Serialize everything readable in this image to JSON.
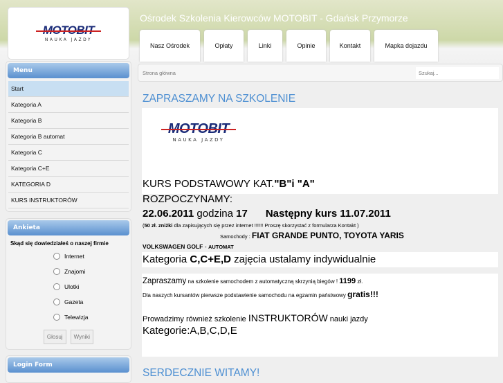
{
  "header": {
    "logo_main": "MOTOBIT",
    "logo_sub": "NAUKA JAZDY",
    "title": "Ośrodek Szkolenia Kierowców MOTOBIT - Gdańsk Przymorze",
    "nav": [
      "Nasz Ośrodek",
      "Opłaty",
      "Linki",
      "Opinie",
      "Kontakt",
      "Mapka dojazdu"
    ]
  },
  "breadcrumb": "Strona główna",
  "search_placeholder": "Szukaj...",
  "menu": {
    "title": "Menu",
    "items": [
      "Start",
      "Kategoria A",
      "Kategoria B",
      "Kategoria B automat",
      "Kategoria C",
      "Kategoria C+E",
      "KATEGORIA D",
      "KURS INSTRUKTORÓW"
    ]
  },
  "poll": {
    "title": "Ankieta",
    "question": "Skąd się dowiedziałeś o naszej firmie",
    "options": [
      "Internet",
      "Znajomi",
      "Ulotki",
      "Gazeta",
      "Telewizja"
    ],
    "vote": "Głosuj",
    "results": "Wyniki"
  },
  "login": {
    "title": "Login Form"
  },
  "content": {
    "heading": "ZAPRASZAMY NA SZKOLENIE",
    "l1a": "KURS PODSTAWOWY KAT.",
    "l1b": "\"B\"i \"A\"",
    "l2": "ROZPOCZYNAMY:",
    "d1": "22.06.2011",
    "d2": " godzina ",
    "d3": "17",
    "d4": "Następny kurs 11.07.2011",
    "disc_b": "50 zł. zniżki",
    "disc": " dla zapisujących się przez internet !!!!!! Proszę skorzystać z formularza Kontakt )",
    "disc_open": "(",
    "cars_label": "Samochody : ",
    "cars": "FIAT GRANDE PUNTO, TOYOTA YARIS",
    "golf": "VOLKSWAGEN GOLF",
    "golf_sep": " - ",
    "auto": "AUTOMAT",
    "cat_a": "Kategoria ",
    "cat_b": "C,C+E,D",
    "cat_c": " zajęcia ustalamy indywidualnie",
    "auto1a": "Zapraszamy",
    "auto1b": " na szkolenie samochodem z automatyczną skrzynią biegów !    ",
    "price": "1199",
    "price_unit": " zł.",
    "auto2a": "Dla naszych kursantów pierwsze podstawienie samochodu na egzamin państwowy ",
    "gratis": "gratis!!!",
    "instr_a": "Prowadzimy również szkolenie ",
    "instr_b": "INSTRUKTORÓW",
    "instr_c": " nauki jazdy",
    "instr_cats": "Kategorie:A,B,C,D,E",
    "heading2": "SERDECZNIE WITAMY!"
  }
}
